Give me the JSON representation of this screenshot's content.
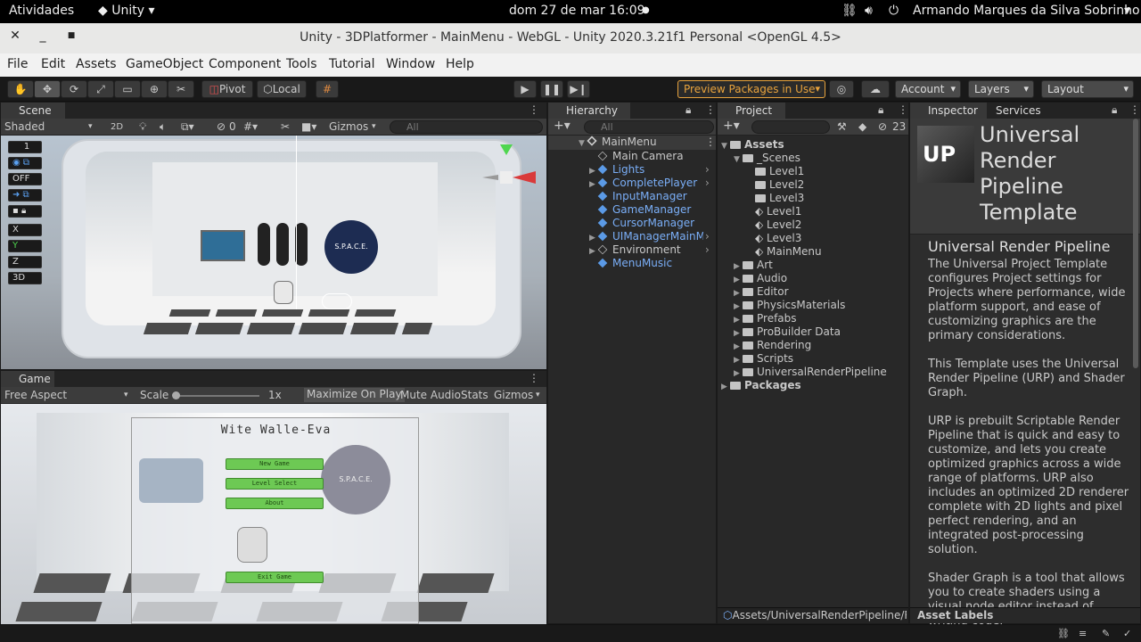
{
  "system_bar": {
    "activities": "Atividades",
    "app": "Unity",
    "clock": "dom 27 de mar  16:09",
    "user": "Armando Marques da Silva Sobrinho"
  },
  "window": {
    "title": "Unity - 3DPlatformer - MainMenu - WebGL - Unity 2020.3.21f1 Personal <OpenGL 4.5>"
  },
  "menu": [
    "File",
    "Edit",
    "Assets",
    "GameObject",
    "Component",
    "Tools",
    "Tutorial",
    "Window",
    "Help"
  ],
  "toolbar": {
    "pivot": "Pivot",
    "local": "Local",
    "preview_packages": "Preview Packages in Use",
    "account": "Account",
    "layers": "Layers",
    "layout": "Layout"
  },
  "scene": {
    "tab": "Scene",
    "shading": "Shaded",
    "mode2d": "2D",
    "hidden_count": "0",
    "gizmos": "Gizmos",
    "search_placeholder": "All",
    "gizmo_labels": [
      "1",
      "OFF",
      "X",
      "Y",
      "Z",
      "3D"
    ],
    "poster_text": "S.P.A.C.E."
  },
  "game": {
    "tab": "Game",
    "aspect": "Free Aspect",
    "scale_label": "Scale",
    "scale_value": "1x",
    "maximize": "Maximize On Play",
    "mute": "Mute Audio",
    "stats": "Stats",
    "gizmos": "Gizmos",
    "title": "Wite Walle-Eva",
    "buttons": [
      "New Game",
      "Level Select",
      "About",
      "Exit Game"
    ],
    "poster_text": "S.P.A.C.E."
  },
  "hierarchy": {
    "tab": "Hierarchy",
    "search_placeholder": "All",
    "root": "MainMenu",
    "items": [
      {
        "label": "Main Camera",
        "type": "object",
        "expandable": false
      },
      {
        "label": "Lights",
        "type": "prefab",
        "expandable": true
      },
      {
        "label": "CompletePlayer",
        "type": "prefab",
        "expandable": true
      },
      {
        "label": "InputManager",
        "type": "prefab",
        "expandable": false
      },
      {
        "label": "GameManager",
        "type": "prefab",
        "expandable": false
      },
      {
        "label": "CursorManager",
        "type": "prefab",
        "expandable": false
      },
      {
        "label": "UIManagerMainMe",
        "type": "prefab",
        "expandable": true
      },
      {
        "label": "Environment",
        "type": "object",
        "expandable": true
      },
      {
        "label": "MenuMusic",
        "type": "prefab",
        "expandable": false
      }
    ]
  },
  "project": {
    "tab": "Project",
    "hidden_count": "23",
    "assets": "Assets",
    "scenes_folder": "_Scenes",
    "scenes_children": [
      {
        "label": "Level1",
        "kind": "folder"
      },
      {
        "label": "Level2",
        "kind": "folder"
      },
      {
        "label": "Level3",
        "kind": "folder"
      },
      {
        "label": "Level1",
        "kind": "scene"
      },
      {
        "label": "Level2",
        "kind": "scene"
      },
      {
        "label": "Level3",
        "kind": "scene"
      },
      {
        "label": "MainMenu",
        "kind": "scene"
      }
    ],
    "folders": [
      "Art",
      "Audio",
      "Editor",
      "PhysicsMaterials",
      "Prefabs",
      "ProBuilder Data",
      "Rendering",
      "Scripts",
      "UniversalRenderPipeline"
    ],
    "packages": "Packages",
    "footer_path": "Assets/UniversalRenderPipeline/Read"
  },
  "inspector": {
    "tab": "Inspector",
    "tab2": "Services",
    "thumb_text": "UP",
    "title": "Universal Render Pipeline Template",
    "heading": "Universal Render Pipeline",
    "paragraphs": [
      "The Universal Project Template configures Project settings for Projects where performance, wide platform support, and ease of customizing graphics are the primary considerations.",
      "This Template uses the Universal Render Pipeline (URP) and Shader Graph.",
      "URP is prebuilt Scriptable Render Pipeline that is quick and easy to customize, and lets you create optimized graphics across a wide range of platforms. URP also includes an optimized 2D renderer complete with 2D lights and pixel perfect rendering, and an integrated post-processing solution.",
      "Shader Graph is a tool that allows you to create shaders using a visual node editor instead of writing code."
    ],
    "asset_labels": "Asset Labels"
  },
  "colors": {
    "accent_orange": "#e8a33d",
    "prefab_blue": "#7aaef7",
    "button_green": "#6dc954"
  }
}
